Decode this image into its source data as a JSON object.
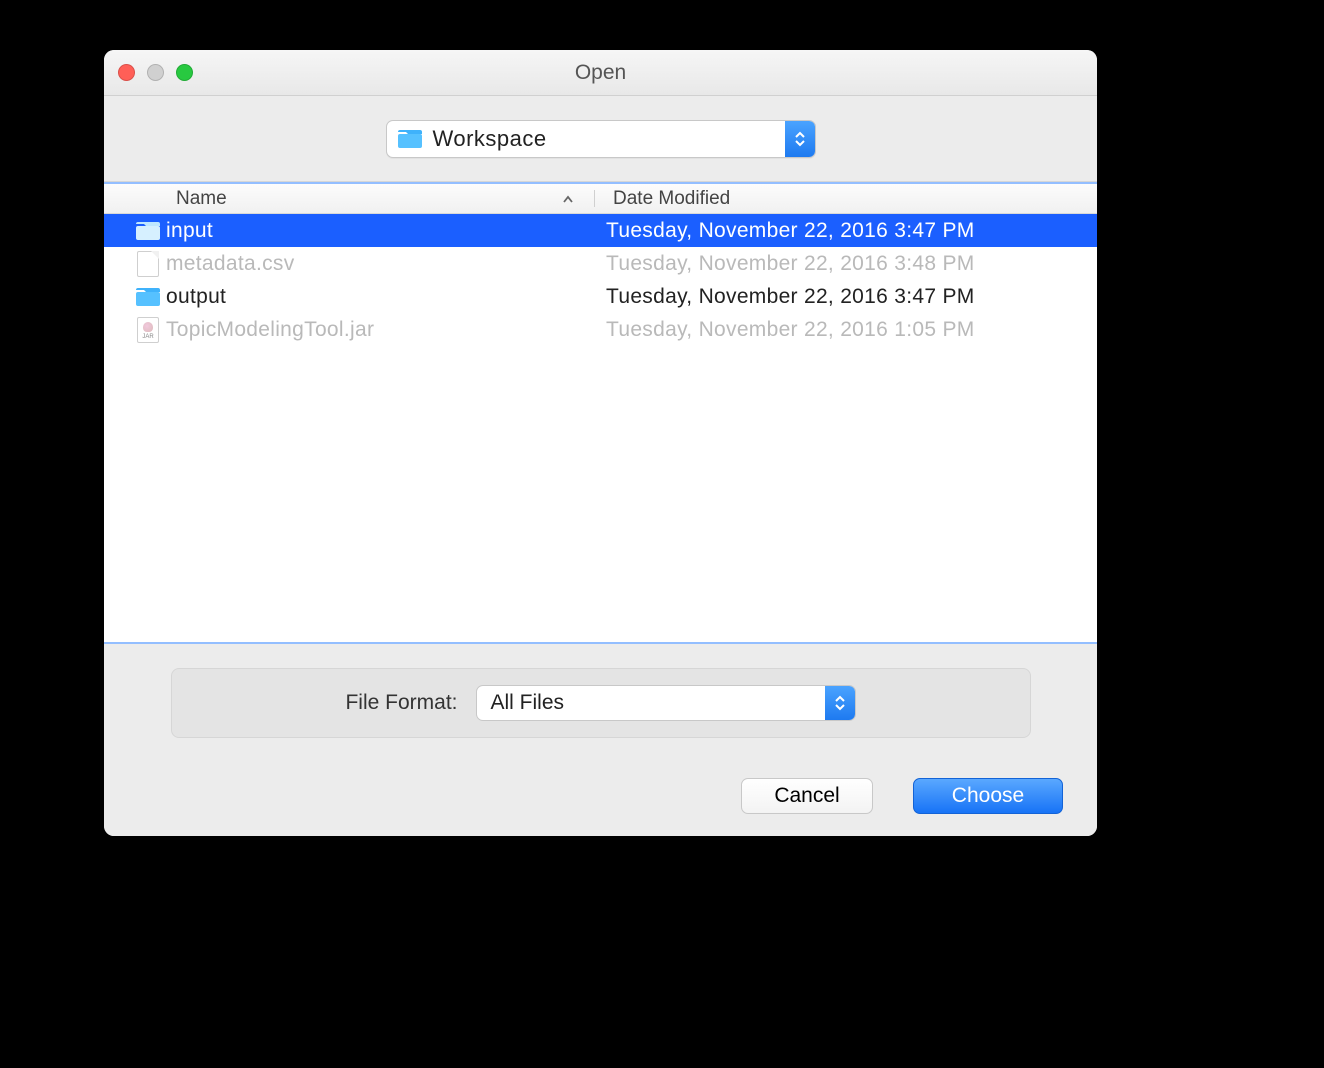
{
  "window": {
    "title": "Open"
  },
  "directory": {
    "current": "Workspace"
  },
  "columns": {
    "name": "Name",
    "date": "Date Modified"
  },
  "files": [
    {
      "name": "input",
      "date": "Tuesday, November 22, 2016 3:47 PM",
      "type": "folder",
      "state": "selected"
    },
    {
      "name": "metadata.csv",
      "date": "Tuesday, November 22, 2016 3:48 PM",
      "type": "file",
      "state": "disabled"
    },
    {
      "name": "output",
      "date": "Tuesday, November 22, 2016 3:47 PM",
      "type": "folder",
      "state": "enabled"
    },
    {
      "name": "TopicModelingTool.jar",
      "date": "Tuesday, November 22, 2016 1:05 PM",
      "type": "jar",
      "state": "disabled"
    }
  ],
  "format": {
    "label": "File Format:",
    "value": "All Files"
  },
  "buttons": {
    "cancel": "Cancel",
    "choose": "Choose"
  },
  "jar_label": "JAR"
}
